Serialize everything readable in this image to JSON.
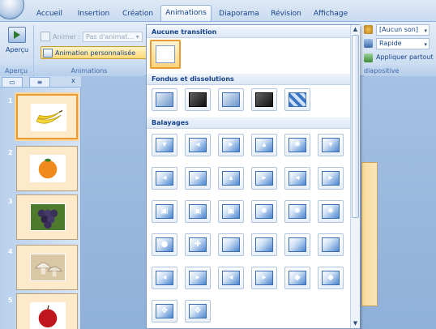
{
  "tabs": [
    {
      "label": "Accueil",
      "active": false
    },
    {
      "label": "Insertion",
      "active": false
    },
    {
      "label": "Création",
      "active": false
    },
    {
      "label": "Animations",
      "active": true
    },
    {
      "label": "Diaporama",
      "active": false
    },
    {
      "label": "Révision",
      "active": false
    },
    {
      "label": "Affichage",
      "active": false
    }
  ],
  "ribbon": {
    "apercu": {
      "label": "Aperçu",
      "group": "Aperçu"
    },
    "animations_group": {
      "animer_label": "Animer :",
      "animer_value": "Pas d'animat...",
      "custom_animation": "Animation personnalisée",
      "group": "Animations"
    },
    "transition": {
      "sound_value": "[Aucun son]",
      "speed_value": "Rapide",
      "apply_all": "Appliquer partout",
      "group": "diapositive"
    }
  },
  "panel": {
    "tab_slides": "",
    "tab_outline": "",
    "close": "x"
  },
  "slides": [
    {
      "number": "1",
      "subject": "bananas",
      "selected": true
    },
    {
      "number": "2",
      "subject": "orange",
      "selected": false
    },
    {
      "number": "3",
      "subject": "grapes",
      "selected": false
    },
    {
      "number": "4",
      "subject": "mushrooms",
      "selected": false
    },
    {
      "number": "5",
      "subject": "apple",
      "selected": false
    }
  ],
  "gallery": {
    "section_none": "Aucune transition",
    "section_fades": "Fondus et dissolutions",
    "section_wipes": "Balayages",
    "fades": [
      "fade-smooth",
      "fade-through-black",
      "cut",
      "cut-through-black",
      "dissolve"
    ],
    "wipes_rows": [
      [
        "wipe-down",
        "wipe-left",
        "wipe-right",
        "wipe-up",
        "wheel-4",
        "wheel-down"
      ],
      [
        "push-left",
        "push-right",
        "uncover-up",
        "uncover-up-right",
        "cover-down-left",
        "cover-down-right"
      ],
      [
        "box-in",
        "box-out",
        "box-expand",
        "clock-wedge",
        "clock-wheel",
        "wheel-8"
      ],
      [
        "shape-circle",
        "shape-plus",
        "split-horizontal-in",
        "split-horizontal-out",
        "split-vertical-in",
        "split-vertical-out"
      ],
      [
        "strips-left-down",
        "strips-right-down",
        "strips-left-up",
        "strips-right-up",
        "shape-diamond",
        "shape-diamond-in"
      ],
      [
        "zoom-in",
        "zoom-and-rotate"
      ]
    ]
  },
  "colors": {
    "ribbon_bg": "#d1e0f2",
    "accent_text": "#15428b",
    "selected_orange": "#e89b32",
    "slide_bg": "#fdeacb"
  },
  "icons": {
    "apercu": "play-preview-icon",
    "sound": "sound-icon",
    "speed": "speed-icon",
    "apply_all": "apply-all-icon"
  }
}
